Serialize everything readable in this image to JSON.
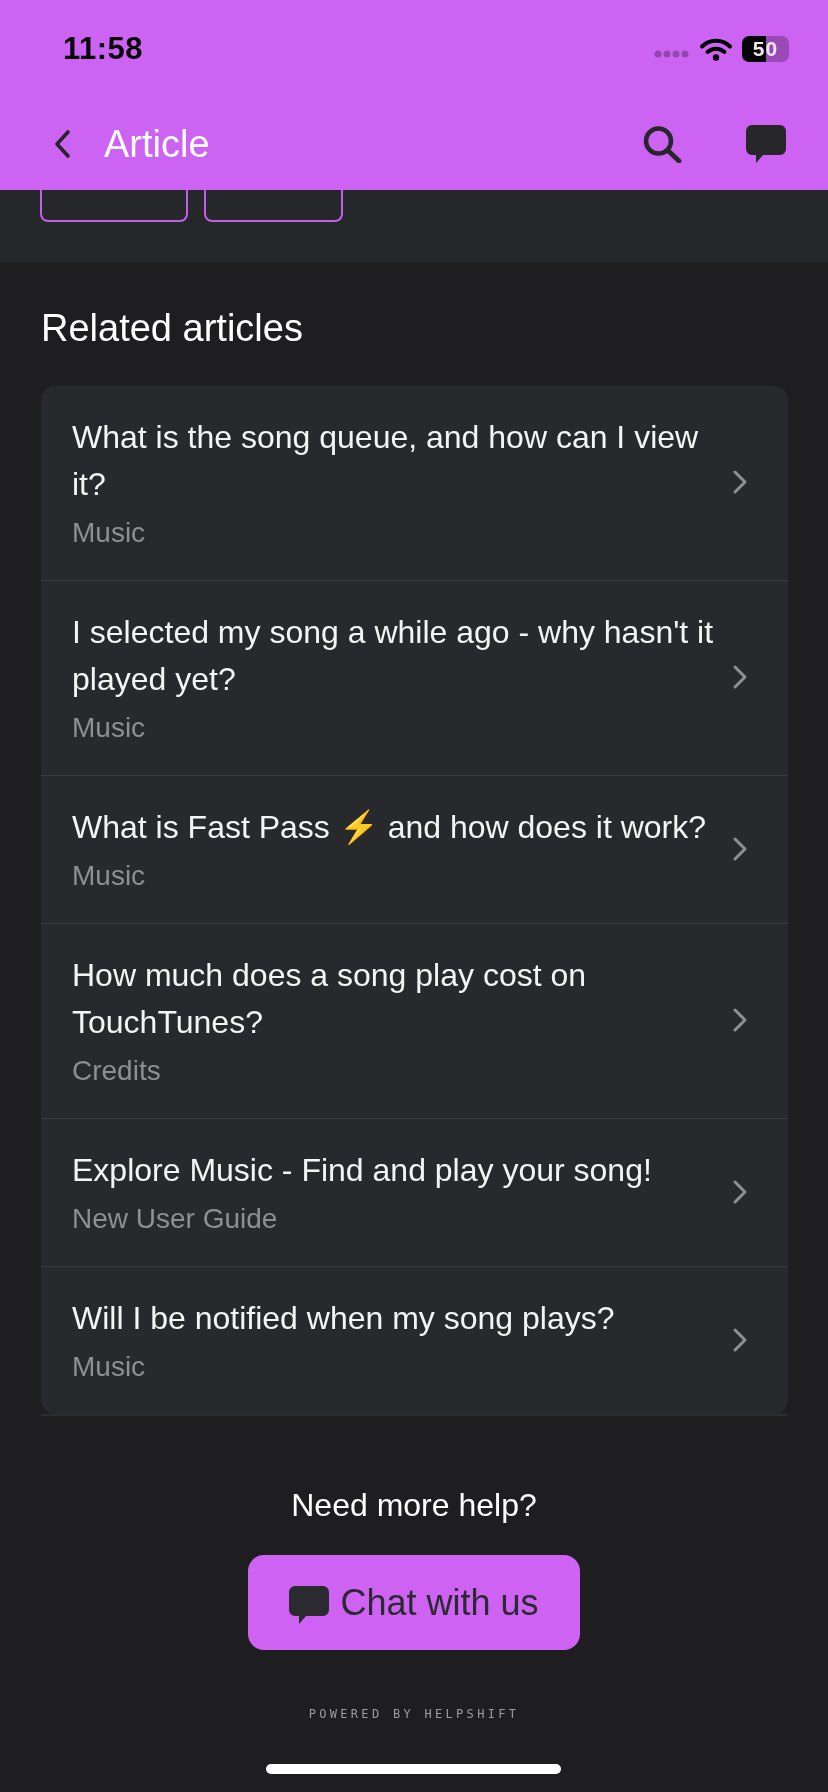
{
  "status_bar": {
    "time": "11:58",
    "battery_percent": "50"
  },
  "header": {
    "title": "Article"
  },
  "related": {
    "heading": "Related articles",
    "articles": [
      {
        "title": "What is the song queue, and how can I view it?",
        "category": "Music"
      },
      {
        "title": "I selected my song a while ago - why hasn't it played yet?",
        "category": "Music"
      },
      {
        "title": "What is Fast Pass ⚡ and how does it work?",
        "category": "Music"
      },
      {
        "title": "How much does a song play cost on TouchTunes?",
        "category": "Credits"
      },
      {
        "title": "Explore Music - Find and play your song!",
        "category": "New User Guide"
      },
      {
        "title": "Will I be notified when my song plays?",
        "category": "Music"
      }
    ]
  },
  "footer": {
    "prompt": "Need more help?",
    "chat_button": "Chat with us",
    "powered_by": "POWERED BY HELPSHIFT"
  }
}
